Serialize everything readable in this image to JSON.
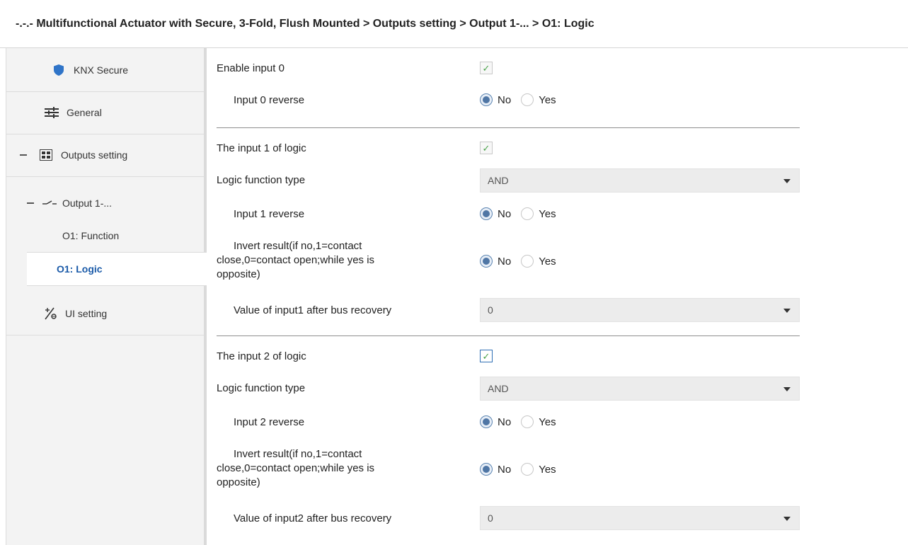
{
  "title": "-.-.- Multifunctional Actuator with Secure, 3-Fold, Flush Mounted > Outputs setting > Output 1-... > O1: Logic",
  "sidebar": {
    "knx_secure": "KNX Secure",
    "general": "General",
    "outputs_setting": "Outputs setting",
    "output_1": "Output 1-...",
    "o1_function": "O1: Function",
    "o1_logic": "O1: Logic",
    "ui_setting": "UI setting"
  },
  "form": {
    "enable_input0": {
      "label": "Enable input 0",
      "checked": true
    },
    "input0_reverse": {
      "label": "Input 0 reverse",
      "selected": "No"
    },
    "input1_logic": {
      "label": "The input 1 of logic",
      "checked": true
    },
    "logic1_type": {
      "label": "Logic function type",
      "value": "AND"
    },
    "input1_reverse": {
      "label": "Input 1 reverse",
      "selected": "No"
    },
    "invert1": {
      "label_lines": [
        "Invert result(if no,1=contact",
        "close,0=contact open;while yes is",
        "opposite)"
      ],
      "selected": "No"
    },
    "value1_recovery": {
      "label": "Value of input1 after bus recovery",
      "value": "0"
    },
    "input2_logic": {
      "label": "The input 2 of logic",
      "checked": true
    },
    "logic2_type": {
      "label": "Logic function type",
      "value": "AND"
    },
    "input2_reverse": {
      "label": "Input 2 reverse",
      "selected": "No"
    },
    "invert2": {
      "label_lines": [
        "Invert result(if no,1=contact",
        "close,0=contact open;while yes is",
        "opposite)"
      ],
      "selected": "No"
    },
    "value2_recovery": {
      "label": "Value of input2 after bus recovery",
      "value": "0"
    }
  },
  "options": {
    "no": "No",
    "yes": "Yes"
  },
  "icons": {
    "check": "checkmark-icon",
    "shield": "shield-icon",
    "general": "sliders-icon",
    "outputs": "grid-icon",
    "output": "switch-contact-icon",
    "ui": "ui-setting-icon"
  },
  "colors": {
    "selected_text": "#1a5aa8",
    "shield": "#2f74c8",
    "check": "#4aa34a"
  }
}
